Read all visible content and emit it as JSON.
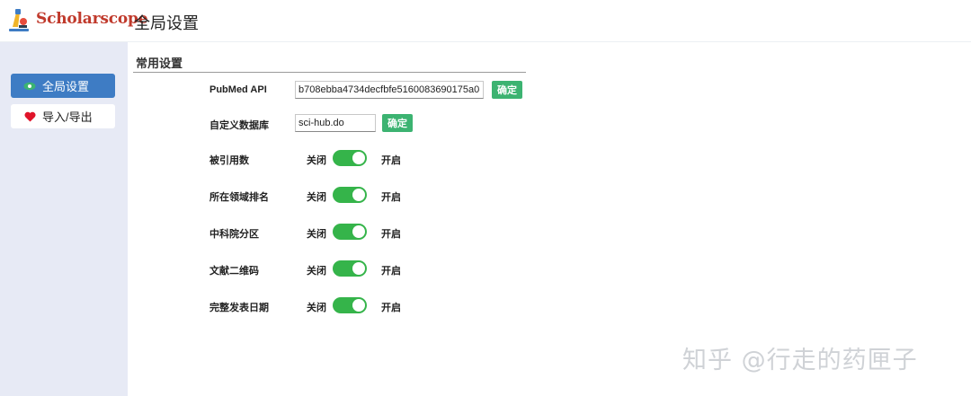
{
  "header": {
    "brand": "Scholarscope",
    "page_title": "全局设置"
  },
  "sidebar": {
    "items": [
      {
        "label": "全局设置",
        "icon": "eye-icon",
        "active": true
      },
      {
        "label": "导入/导出",
        "icon": "heart-icon",
        "active": false
      }
    ]
  },
  "section": {
    "title": "常用设置"
  },
  "settings": {
    "pubmed_api": {
      "label": "PubMed API",
      "value": "b708ebba4734decfbfe5160083690175a0(",
      "button": "确定"
    },
    "custom_db": {
      "label": "自定义数据库",
      "value": "sci-hub.do",
      "button": "确定"
    },
    "toggles": [
      {
        "label": "被引用数",
        "off": "关闭",
        "on": "开启",
        "state": true
      },
      {
        "label": "所在领域排名",
        "off": "关闭",
        "on": "开启",
        "state": true
      },
      {
        "label": "中科院分区",
        "off": "关闭",
        "on": "开启",
        "state": true
      },
      {
        "label": "文献二维码",
        "off": "关闭",
        "on": "开启",
        "state": true
      },
      {
        "label": "完整发表日期",
        "off": "关闭",
        "on": "开启",
        "state": true
      }
    ]
  },
  "watermark": "知乎 @行走的药匣子",
  "colors": {
    "brand": "#c0392b",
    "active_nav": "#3e7cc4",
    "toggle_on": "#35b44a",
    "confirm_button": "#3cb371",
    "sidebar_bg": "#e7eaf5"
  }
}
